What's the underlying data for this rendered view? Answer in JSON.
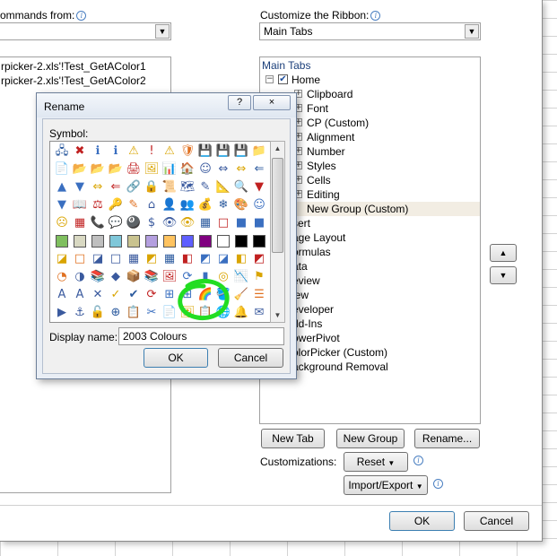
{
  "left_panel": {
    "commands_from_label": "ommands from:",
    "commands_from_value": "",
    "list_items": [
      "rpicker-2.xls'!Test_GetAColor1",
      "rpicker-2.xls'!Test_GetAColor2"
    ]
  },
  "right_panel": {
    "customize_label": "Customize the Ribbon:",
    "customize_value": "Main Tabs",
    "tree_header": "Main Tabs",
    "tree": [
      {
        "label": "Home",
        "level": 0,
        "expander": "minus",
        "checked": true
      },
      {
        "label": "Clipboard",
        "level": 1,
        "expander": "plus"
      },
      {
        "label": "Font",
        "level": 1,
        "expander": "plus"
      },
      {
        "label": "CP (Custom)",
        "level": 1,
        "expander": "plus"
      },
      {
        "label": "Alignment",
        "level": 1,
        "expander": "plus"
      },
      {
        "label": "Number",
        "level": 1,
        "expander": "plus"
      },
      {
        "label": "Styles",
        "level": 1,
        "expander": "plus"
      },
      {
        "label": "Cells",
        "level": 1,
        "expander": "plus"
      },
      {
        "label": "Editing",
        "level": 1,
        "expander": "plus"
      },
      {
        "label": "New Group (Custom)",
        "level": 1,
        "expander": "none",
        "selected": true
      },
      {
        "label": "sert",
        "level": 0
      },
      {
        "label": "age Layout",
        "level": 0
      },
      {
        "label": "ormulas",
        "level": 0
      },
      {
        "label": "ata",
        "level": 0
      },
      {
        "label": "eview",
        "level": 0
      },
      {
        "label": "iew",
        "level": 0
      },
      {
        "label": "eveloper",
        "level": 0
      },
      {
        "label": "dd-Ins",
        "level": 0
      },
      {
        "label": "owerPivot",
        "level": 0
      },
      {
        "label": "olorPicker (Custom)",
        "level": 0
      },
      {
        "label": "ackground Removal",
        "level": 0
      }
    ],
    "new_tab_label": "New Tab",
    "new_group_label": "New Group",
    "rename_label": "Rename...",
    "customizations_label": "Customizations:",
    "reset_label": "Reset",
    "import_export_label": "Import/Export"
  },
  "footer": {
    "ok_label": "OK",
    "cancel_label": "Cancel"
  },
  "rename_dialog": {
    "title": "Rename",
    "help_label": "?",
    "close_label": "×",
    "symbol_label": "Symbol:",
    "display_name_label": "Display name:",
    "display_name_value": "2003 Colours",
    "ok_label": "OK",
    "cancel_label": "Cancel",
    "highlight_color": "#22dd22",
    "symbols": [
      [
        "🖧",
        "✖",
        "ℹ",
        "ℹ",
        "⚠",
        "!",
        "⚠",
        "🛡",
        "💾",
        "💾",
        "💾",
        "📁"
      ],
      [
        "📄",
        "📂",
        "📂",
        "📂",
        "🖨",
        "🖼",
        "📊",
        "🏠",
        "☺",
        "⇔",
        "⇔",
        "⇐"
      ],
      [
        "▲",
        "▼",
        "⇔",
        "⇐",
        "🔗",
        "🔒",
        "📜",
        "🗺",
        "✎",
        "📐",
        "🔍",
        "▼"
      ],
      [
        "▼",
        "📖",
        "⚖",
        "🔑",
        "✎",
        "⌂",
        "👤",
        "👥",
        "💰",
        "❄",
        "🎨",
        "☺"
      ],
      [
        "☹",
        "▦",
        "📞",
        "💬",
        "🎱",
        "$",
        "👁",
        "👁",
        "▦",
        "□",
        "■",
        "■"
      ],
      [
        "■",
        "■",
        "■",
        "■",
        "■",
        "■",
        "■",
        "■",
        "■",
        "■",
        "◪",
        "■"
      ],
      [
        "◪",
        "□",
        "◪",
        "□",
        "▦",
        "◩",
        "▦",
        "◧",
        "◩",
        "◪",
        "◧",
        "◩"
      ],
      [
        "◔",
        "◑",
        "📚",
        "◆",
        "📦",
        "📚",
        "🖼",
        "⟳",
        "▮",
        "◎",
        "📉",
        "⚑"
      ],
      [
        "A",
        "A",
        "✕",
        "✓",
        "✔",
        "⟳",
        "⊞",
        "⊞",
        "🌈",
        "🪣",
        "🧹",
        "☰"
      ],
      [
        "▶",
        "⚓",
        "🔓",
        "⊕",
        "📋",
        "✂",
        "📄",
        "🖼",
        "📋",
        "🌐",
        "🔔",
        "✉"
      ]
    ],
    "swatch_colors": [
      "#7fbf5f",
      "#d9d9c3",
      "#bfbfbf",
      "#7fc7d9",
      "#c9c38f",
      "#b49fdf",
      "#ffc35f",
      "#5f5fff",
      "#800080",
      "#ffffff",
      "#000000",
      "#000000"
    ]
  }
}
